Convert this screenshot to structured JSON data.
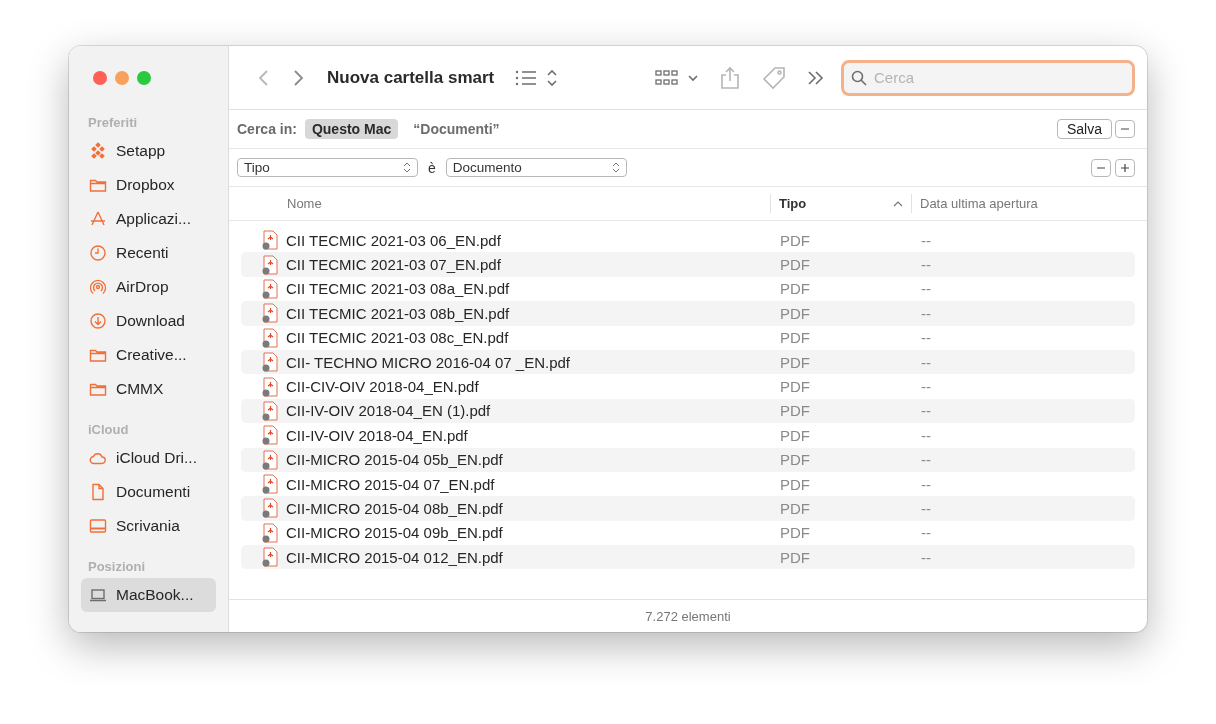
{
  "window": {
    "title": "Nuova cartella smart"
  },
  "sidebar": {
    "sections": [
      {
        "heading": "Preferiti",
        "items": [
          {
            "label": "Setapp",
            "kind": "app",
            "selected": false
          },
          {
            "label": "Dropbox",
            "kind": "folder",
            "selected": false
          },
          {
            "label": "Applicazi...",
            "kind": "apps",
            "selected": false
          },
          {
            "label": "Recenti",
            "kind": "clock",
            "selected": false
          },
          {
            "label": "AirDrop",
            "kind": "airdrop",
            "selected": false
          },
          {
            "label": "Download",
            "kind": "download",
            "selected": false
          },
          {
            "label": "Creative...",
            "kind": "folder",
            "selected": false
          },
          {
            "label": "CMMX",
            "kind": "folder",
            "selected": false
          }
        ]
      },
      {
        "heading": "iCloud",
        "items": [
          {
            "label": "iCloud Dri...",
            "kind": "cloud",
            "selected": false
          },
          {
            "label": "Documenti",
            "kind": "document",
            "selected": false
          },
          {
            "label": "Scrivania",
            "kind": "desktop",
            "selected": false
          }
        ]
      },
      {
        "heading": "Posizioni",
        "items": [
          {
            "label": "MacBook...",
            "kind": "laptop",
            "selected": true
          }
        ]
      }
    ]
  },
  "search": {
    "placeholder": "Cerca",
    "focused": true
  },
  "scope": {
    "label": "Cerca in:",
    "options": [
      {
        "label": "Questo Mac",
        "selected": true
      },
      {
        "label": "“Documenti”",
        "selected": false
      }
    ],
    "save": "Salva"
  },
  "criteria": {
    "attribute": "Tipo",
    "operator": "è",
    "value": "Documento"
  },
  "table": {
    "columns": [
      {
        "label": "Nome",
        "sorted": false
      },
      {
        "label": "Tipo",
        "sorted": true
      },
      {
        "label": "Data ultima apertura",
        "sorted": false
      }
    ],
    "rows": [
      {
        "name": "CII TECMIC 2021-03 06_EN.pdf",
        "type": "PDF",
        "opened": "--"
      },
      {
        "name": "CII TECMIC 2021-03 07_EN.pdf",
        "type": "PDF",
        "opened": "--"
      },
      {
        "name": "CII TECMIC 2021-03 08a_EN.pdf",
        "type": "PDF",
        "opened": "--"
      },
      {
        "name": "CII TECMIC 2021-03 08b_EN.pdf",
        "type": "PDF",
        "opened": "--"
      },
      {
        "name": "CII TECMIC 2021-03 08c_EN.pdf",
        "type": "PDF",
        "opened": "--"
      },
      {
        "name": "CII- TECHNO MICRO 2016-04 07 _EN.pdf",
        "type": "PDF",
        "opened": "--"
      },
      {
        "name": "CII-CIV-OIV 2018-04_EN.pdf",
        "type": "PDF",
        "opened": "--"
      },
      {
        "name": "CII-IV-OIV 2018-04_EN (1).pdf",
        "type": "PDF",
        "opened": "--"
      },
      {
        "name": "CII-IV-OIV 2018-04_EN.pdf",
        "type": "PDF",
        "opened": "--"
      },
      {
        "name": "CII-MICRO 2015-04 05b_EN.pdf",
        "type": "PDF",
        "opened": "--"
      },
      {
        "name": "CII-MICRO 2015-04 07_EN.pdf",
        "type": "PDF",
        "opened": "--"
      },
      {
        "name": "CII-MICRO 2015-04 08b_EN.pdf",
        "type": "PDF",
        "opened": "--"
      },
      {
        "name": "CII-MICRO 2015-04 09b_EN.pdf",
        "type": "PDF",
        "opened": "--"
      },
      {
        "name": "CII-MICRO 2015-04 012_EN.pdf",
        "type": "PDF",
        "opened": "--"
      }
    ]
  },
  "status_bar": "7.272 elementi"
}
